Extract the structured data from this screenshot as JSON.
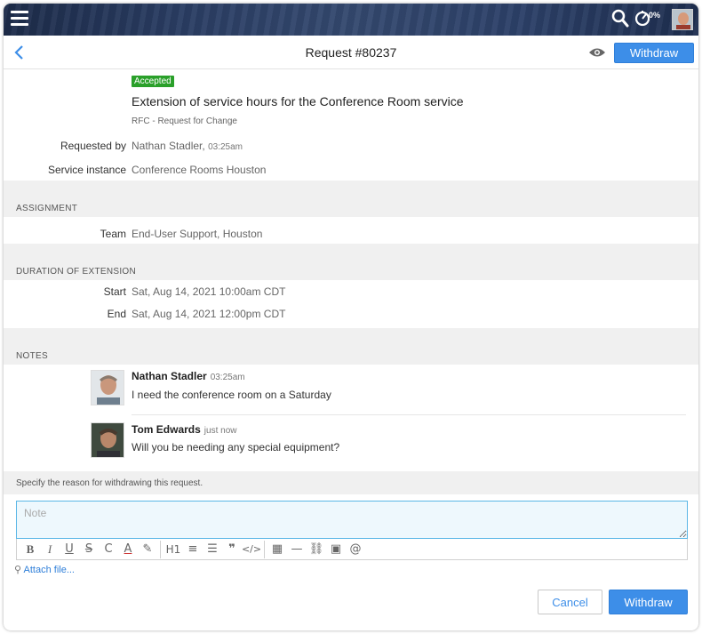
{
  "topbar": {
    "time_tracking_percent": "0%"
  },
  "header": {
    "title": "Request #80237",
    "withdraw_label": "Withdraw"
  },
  "request": {
    "status": "Accepted",
    "status_color": "#2aa02a",
    "subject": "Extension of service hours for the Conference Room service",
    "type": "RFC - Request for Change",
    "requested_by_label": "Requested by",
    "requested_by": "Nathan Stadler,",
    "requested_time": "03:25am",
    "service_instance_label": "Service instance",
    "service_instance": "Conference Rooms Houston"
  },
  "assignment": {
    "title": "ASSIGNMENT",
    "team_label": "Team",
    "team": "End-User Support, Houston"
  },
  "duration": {
    "title": "DURATION OF EXTENSION",
    "start_label": "Start",
    "start": "Sat, Aug 14, 2021 10:00am CDT",
    "end_label": "End",
    "end": "Sat, Aug 14, 2021 12:00pm CDT"
  },
  "notes": {
    "title": "NOTES",
    "items": [
      {
        "author": "Nathan Stadler",
        "time": "03:25am",
        "text": "I need the conference room on a Saturday"
      },
      {
        "author": "Tom Edwards",
        "time": "just now",
        "text": "Will you be needing any special equipment?"
      }
    ]
  },
  "withdraw_form": {
    "instruction": "Specify the reason for withdrawing this request.",
    "note_placeholder": "Note",
    "attach_label": "Attach file...",
    "cancel_label": "Cancel",
    "withdraw_label": "Withdraw"
  },
  "colors": {
    "accent": "#3d8ee8",
    "section_bg": "#f0f0f0",
    "editor_border": "#5bb7e6"
  }
}
